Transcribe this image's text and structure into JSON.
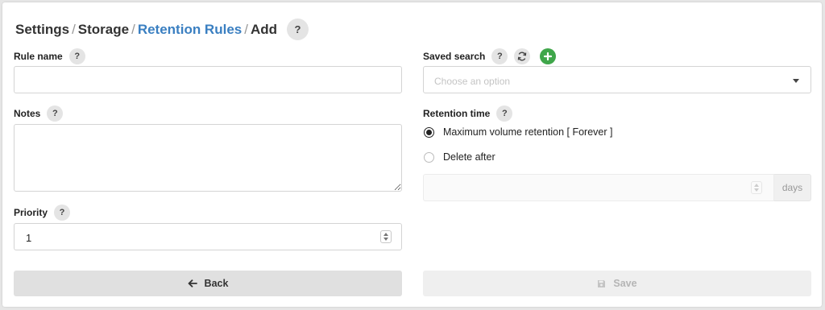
{
  "breadcrumb": {
    "settings": "Settings",
    "storage": "Storage",
    "retention_rules": "Retention Rules",
    "add": "Add",
    "separator": "/"
  },
  "help_label": "?",
  "form": {
    "rule_name": {
      "label": "Rule name",
      "value": ""
    },
    "notes": {
      "label": "Notes",
      "value": ""
    },
    "priority": {
      "label": "Priority",
      "value": "1"
    },
    "saved_search": {
      "label": "Saved search",
      "placeholder": "Choose an option"
    },
    "retention_time": {
      "label": "Retention time",
      "options": [
        {
          "label": "Maximum volume retention [ Forever ]",
          "selected": true
        },
        {
          "label": "Delete after",
          "selected": false
        }
      ],
      "unit": "days",
      "value": ""
    }
  },
  "buttons": {
    "back": "Back",
    "save": "Save"
  },
  "colors": {
    "link": "#3a7fc1",
    "add_green": "#3fa64a"
  },
  "icons": [
    "question-icon",
    "refresh-icon",
    "plus-icon",
    "arrow-left-icon",
    "floppy-disk-icon",
    "caret-down-icon",
    "resize-grip-icon"
  ]
}
